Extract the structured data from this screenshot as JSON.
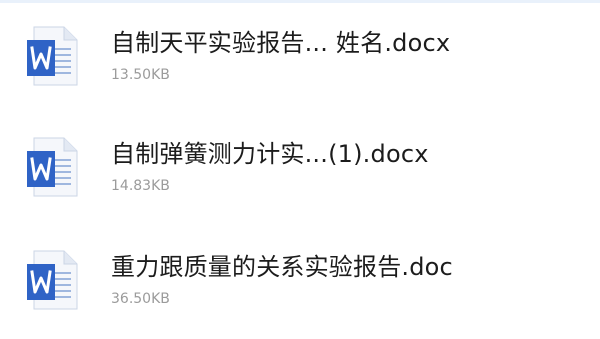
{
  "files": [
    {
      "name": "自制天平实验报告... 姓名.docx",
      "size": "13.50KB",
      "icon": "word-doc-icon"
    },
    {
      "name": "自制弹簧测力计实...(1).docx",
      "size": "14.83KB",
      "icon": "word-doc-icon"
    },
    {
      "name": "重力跟质量的关系实验报告.doc",
      "size": "36.50KB",
      "icon": "word-doc-icon"
    }
  ],
  "colors": {
    "word_blue": "#2f63c6",
    "word_blue_dark": "#2a58b3",
    "page_bg": "#f3f6fb",
    "name_text": "#1c1c1c",
    "size_text": "#9b9b9b"
  }
}
